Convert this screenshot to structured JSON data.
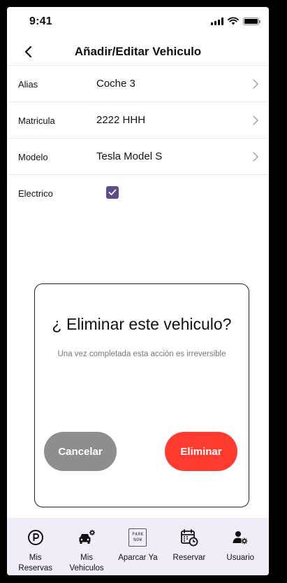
{
  "status_bar": {
    "time": "9:41"
  },
  "header": {
    "title": "Añadir/Editar Vehiculo"
  },
  "form": {
    "rows": [
      {
        "label": "Alias",
        "value": "Coche 3"
      },
      {
        "label": "Matricula",
        "value": "2222 HHH"
      },
      {
        "label": "Modelo",
        "value": "Tesla Model S"
      }
    ],
    "electric": {
      "label": "Electrico",
      "checked": true
    }
  },
  "dialog": {
    "title": "¿ Eliminar este vehiculo?",
    "message": "Una vez completada esta acción es irreversible",
    "cancel_label": "Cancelar",
    "delete_label": "Eliminar"
  },
  "tab_bar": {
    "items": [
      {
        "label": "Mis Reservas",
        "icon": "parking-circle-icon"
      },
      {
        "label": "Mis Vehiculos",
        "icon": "car-settings-icon"
      },
      {
        "label": "Aparcar Ya",
        "icon": "park-now-icon",
        "icon_text": [
          "PARK",
          "NOW"
        ]
      },
      {
        "label": "Reservar",
        "icon": "calendar-clock-icon"
      },
      {
        "label": "Usuario",
        "icon": "user-settings-icon"
      }
    ]
  },
  "colors": {
    "checkbox": "#5f4b8b",
    "cancel_button": "#8e8e8e",
    "delete_button": "#ff3b30",
    "tab_bar_bg": "#f1ecf6"
  }
}
